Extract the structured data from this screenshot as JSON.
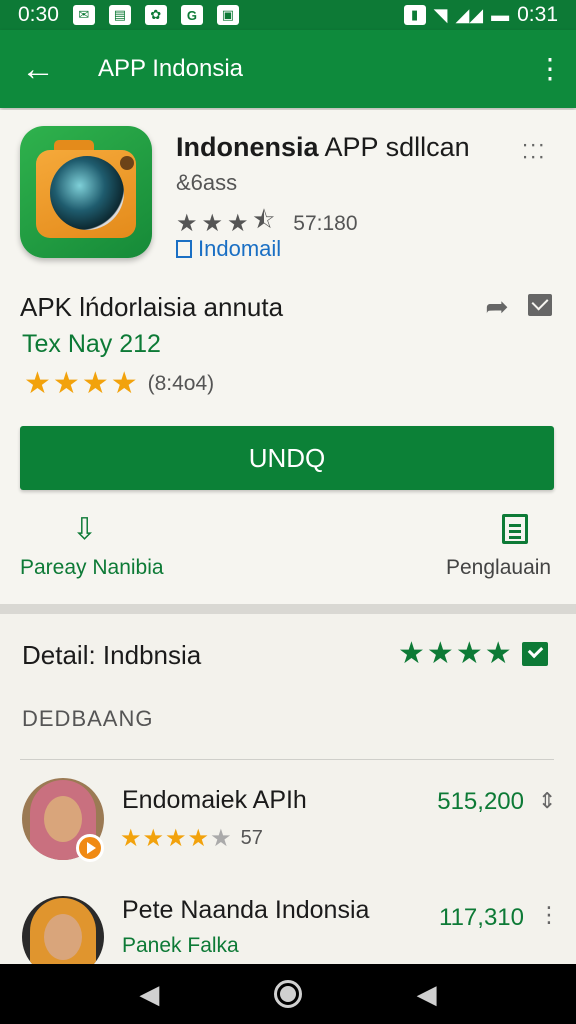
{
  "status_bar": {
    "time_left": "0:30",
    "time_right": "0:31",
    "icons_left": [
      "mail-icon",
      "wallet-icon",
      "gear-icon",
      "g-icon",
      "bag-icon"
    ],
    "icons_right": [
      "battery-save-icon",
      "wifi-icon",
      "signal-icon",
      "battery-icon"
    ]
  },
  "app_bar": {
    "title": "APP Indonsia",
    "back_icon": "arrow-back-icon",
    "overflow_icon": "more-vert-icon"
  },
  "app": {
    "title_bold": "Indonensia",
    "title_rest": " APP sdllcan",
    "subtitle": "&6ass",
    "rating_count": "57:180",
    "developer": "Indomail",
    "apk_title": "APK lńdorlaisia annuta",
    "tex_line": "Tex Nay 212",
    "stars_count": "(8:4o4)",
    "install_label": "UNDQ",
    "action_left_label": "Pareay Nanibia",
    "action_right_label": "Penglauain"
  },
  "details": {
    "title": "Detail: Indbnsia",
    "section_label": "DEDBAANG",
    "reviewers": [
      {
        "name": "Endomaiek APIh",
        "value": "515,200",
        "rating_count": "57",
        "stars": 4
      },
      {
        "name": "Pete Naanda Indonsia",
        "subtitle": "Panek Falka",
        "value": "117,310"
      }
    ]
  },
  "colors": {
    "primary_green": "#0e8a3c",
    "dark_green": "#0d7a36",
    "star_orange": "#f2a20c",
    "link_blue": "#1a6fc4"
  },
  "nav": {
    "back": "back-nav-icon",
    "home": "home-nav-icon",
    "recents": "recents-nav-icon"
  }
}
